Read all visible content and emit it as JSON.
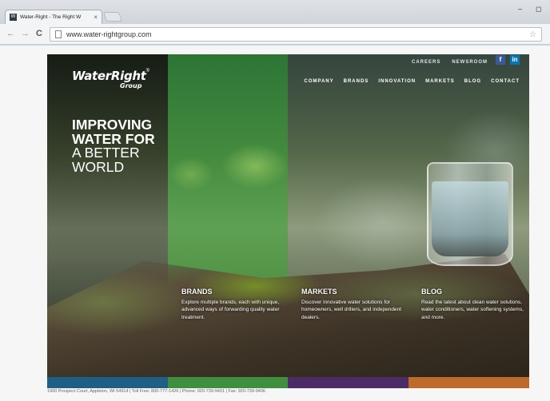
{
  "browser": {
    "tab_favicon": "W",
    "tab_title": "Water-Right - The Right W",
    "tab_close": "×",
    "url": "www.water-rightgroup.com",
    "minimize": "–",
    "maximize": "◻"
  },
  "logo": {
    "main": "WaterRight",
    "registered": "®",
    "sub": "Group"
  },
  "utility_nav": [
    "CAREERS",
    "NEWSROOM"
  ],
  "social": [
    {
      "label": "f",
      "color": "#3b5998"
    },
    {
      "label": "in",
      "color": "#0077b5"
    }
  ],
  "main_nav": [
    "COMPANY",
    "BRANDS",
    "INNOVATION",
    "MARKETS",
    "BLOG",
    "CONTACT"
  ],
  "headline": {
    "line1": "IMPROVING",
    "line2": "WATER FOR",
    "line3": "A BETTER",
    "line4": "WORLD"
  },
  "cards": [
    {
      "title": "BRANDS",
      "text": "Explore multiple brands, each with unique, advanced ways of forwarding quality water treatment."
    },
    {
      "title": "MARKETS",
      "text": "Discover innovative water solutions for homeowners, well drillers, and independent dealers."
    },
    {
      "title": "BLOG",
      "text": "Read the latest about clean water solutions, water conditioners, water softening systems, and more."
    }
  ],
  "color_strip": [
    "#1e5f86",
    "#3f8f3e",
    "#4c2b66",
    "#bd6a2a"
  ],
  "footer": "1900 Prospect Court, Appleton, WI 54914 | Toll Free: 800-777-1426 | Phone: 920-739-9401 | Fax: 920-739-9406"
}
